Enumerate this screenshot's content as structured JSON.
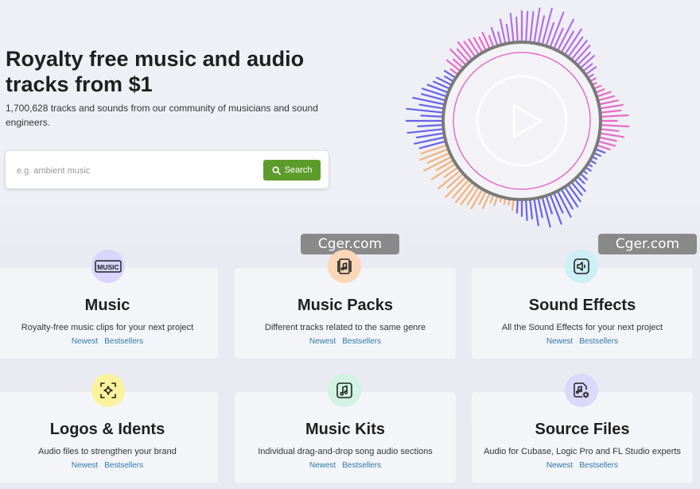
{
  "hero": {
    "title": "Royalty free music and audio tracks from $1",
    "subtitle": "1,700,628 tracks and sounds from our community of musicians and sound engineers."
  },
  "search": {
    "placeholder": "e.g. ambient music",
    "button_label": "Search"
  },
  "watermarks": [
    "Cger.com",
    "Cger.com"
  ],
  "categories": [
    {
      "title": "Music",
      "description": "Royalty-free music clips for your next project",
      "link_newest": "Newest",
      "link_bestsellers": "Bestsellers",
      "icon": "music-label-icon",
      "icon_bg": "#d9d5fb",
      "icon_text": "MUSIC"
    },
    {
      "title": "Music Packs",
      "description": "Different tracks related to the same genre",
      "link_newest": "Newest",
      "link_bestsellers": "Bestsellers",
      "icon": "music-pack-icon",
      "icon_bg": "#fbd7b8"
    },
    {
      "title": "Sound Effects",
      "description": "All the Sound Effects for your next project",
      "link_newest": "Newest",
      "link_bestsellers": "Bestsellers",
      "icon": "speaker-icon",
      "icon_bg": "#cdeff6"
    },
    {
      "title": "Logos & Idents",
      "description": "Audio files to strengthen your brand",
      "link_newest": "Newest",
      "link_bestsellers": "Bestsellers",
      "icon": "sparkle-icon",
      "icon_bg": "#fbf39c"
    },
    {
      "title": "Music Kits",
      "description": "Individual drag-and-drop song audio sections",
      "link_newest": "Newest",
      "link_bestsellers": "Bestsellers",
      "icon": "music-note-icon",
      "icon_bg": "#d2f3e3"
    },
    {
      "title": "Source Files",
      "description": "Audio for Cubase, Logic Pro and FL Studio experts",
      "link_newest": "Newest",
      "link_bestsellers": "Bestsellers",
      "icon": "audio-settings-icon",
      "icon_bg": "#dcd8fb"
    }
  ],
  "colors": {
    "accent_green": "#5d9b2a",
    "link_blue": "#2f78a4",
    "wave_purple": "#b56ee6",
    "wave_blue": "#6a62e8",
    "wave_orange": "#f3b27a",
    "wave_pink": "#e86ac8"
  }
}
